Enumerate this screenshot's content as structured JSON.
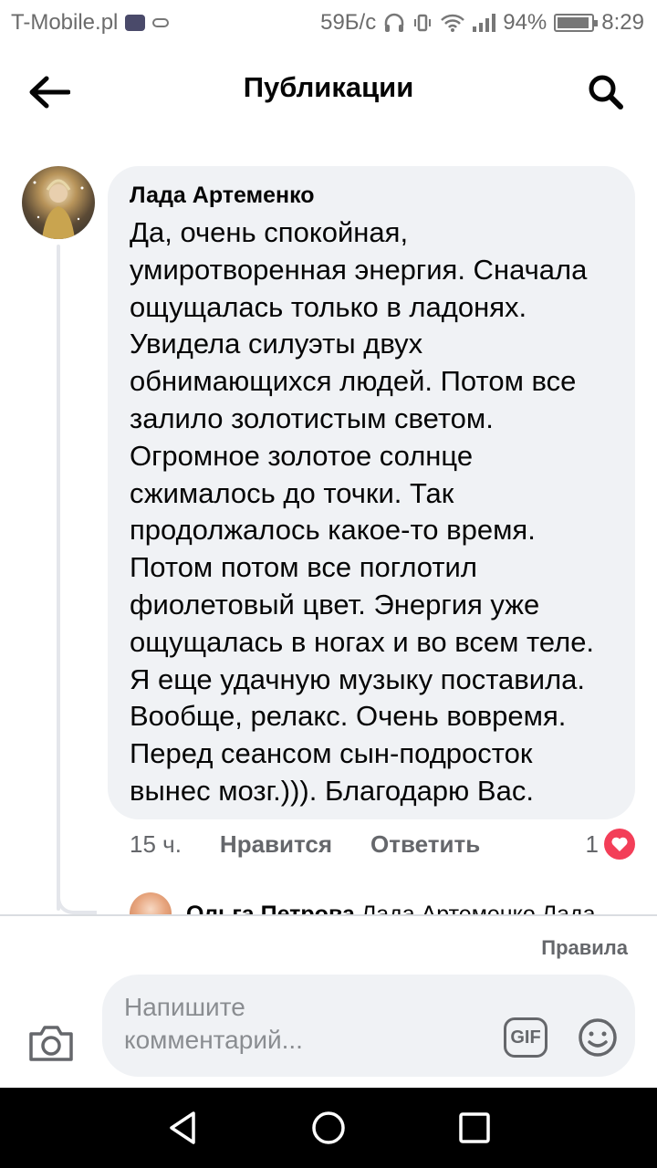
{
  "status_bar": {
    "carrier": "T-Mobile.pl",
    "speed": "59Б/с",
    "battery": "94%",
    "battery_level": 0.94,
    "time": "8:29"
  },
  "header": {
    "title": "Публикации",
    "back_icon": "arrow-left-icon",
    "search_icon": "search-icon"
  },
  "comment": {
    "author": "Лада Артеменко",
    "text": "Да, очень спокойная,\nумиротворенная энергия. Сначала\nощущалась только в ладонях.\nУвидела силуэты двух\nобнимающихся людей. Потом все\nзалило золотистым светом.\nОгромное золотое солнце\nсжималось до точки. Так\nпродолжалось какое-то время.\nПотом потом все поглотил\nфиолетовый цвет. Энергия уже\nощущалась в ногах и во всем теле.\nЯ еще удачную музыку поставила.\nВообще, релакс. Очень вовремя.\nПеред сеансом сын-подросток\nвынес мозг.))). Благодарю Вас.",
    "time": "15 ч.",
    "like_label": "Нравится",
    "reply_label": "Ответить",
    "reaction_count": "1",
    "reaction_icon": "heart-icon"
  },
  "next_reply": {
    "author": "Ольга Петрова",
    "text_preview": "Лада Артеменко Лада"
  },
  "composer": {
    "rules_label": "Правила",
    "placeholder": "Напишите комментарий...",
    "gif_label": "GIF",
    "camera_icon": "camera-icon",
    "emoji_icon": "smiley-icon"
  },
  "nav": {
    "back_icon": "triangle-back-icon",
    "home_icon": "circle-home-icon",
    "recents_icon": "square-recents-icon"
  },
  "colors": {
    "bubble_bg": "#f0f2f5",
    "secondary_text": "#65676b",
    "heart": "#f33e58",
    "nav_bg": "#000000"
  }
}
